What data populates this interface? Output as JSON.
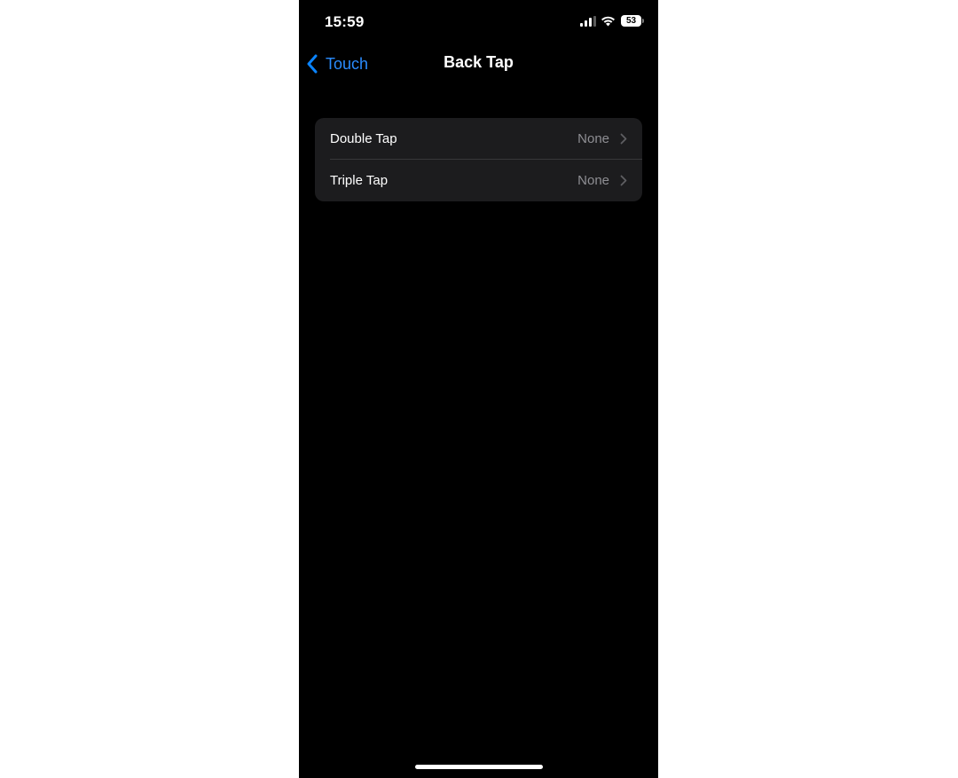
{
  "status_bar": {
    "time": "15:59",
    "battery_level": "53",
    "icons": [
      "signal-icon",
      "wifi-icon",
      "battery-icon"
    ]
  },
  "nav": {
    "back_label": "Touch",
    "title": "Back Tap",
    "back_icon": "chevron-left-icon"
  },
  "settings": {
    "rows": [
      {
        "label": "Double Tap",
        "value": "None",
        "icon": "chevron-right-icon"
      },
      {
        "label": "Triple Tap",
        "value": "None",
        "icon": "chevron-right-icon"
      }
    ]
  },
  "colors": {
    "background": "#000000",
    "group_background": "#1c1c1e",
    "accent": "#0a84ff",
    "secondary_text": "#8e8e93"
  }
}
